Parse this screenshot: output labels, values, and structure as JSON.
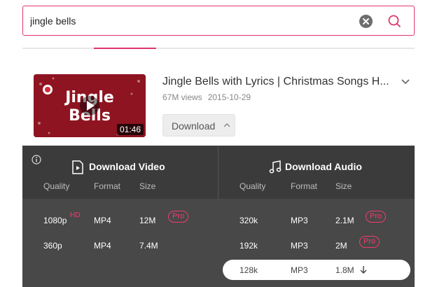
{
  "search": {
    "value": "jingle bells",
    "clear_icon": "close-circle-icon",
    "search_icon": "search-icon"
  },
  "accent_color": "#e0356a",
  "video": {
    "title": "Jingle Bells with Lyrics | Christmas Songs H...",
    "views": "67M views",
    "date": "2015-10-29",
    "duration": "01:46",
    "thumbnail_text": [
      "Jingle",
      "Bells"
    ],
    "download_label": "Download"
  },
  "panel": {
    "video_section": {
      "title": "Download Video",
      "headers": [
        "Quality",
        "Format",
        "Size"
      ],
      "rows": [
        {
          "quality": "1080p",
          "hd": "HD",
          "format": "MP4",
          "size": "12M",
          "pro": "Pro"
        },
        {
          "quality": "360p",
          "hd": "",
          "format": "MP4",
          "size": "7.4M",
          "pro": ""
        }
      ]
    },
    "audio_section": {
      "title": "Download Audio",
      "headers": [
        "Quality",
        "Format",
        "Size"
      ],
      "rows": [
        {
          "quality": "320k",
          "format": "MP3",
          "size": "2.1M",
          "pro": "Pro"
        },
        {
          "quality": "192k",
          "format": "MP3",
          "size": "2M",
          "pro": "Pro"
        },
        {
          "quality": "128k",
          "format": "MP3",
          "size": "1.8M",
          "pro": "",
          "selected": true
        }
      ]
    }
  }
}
